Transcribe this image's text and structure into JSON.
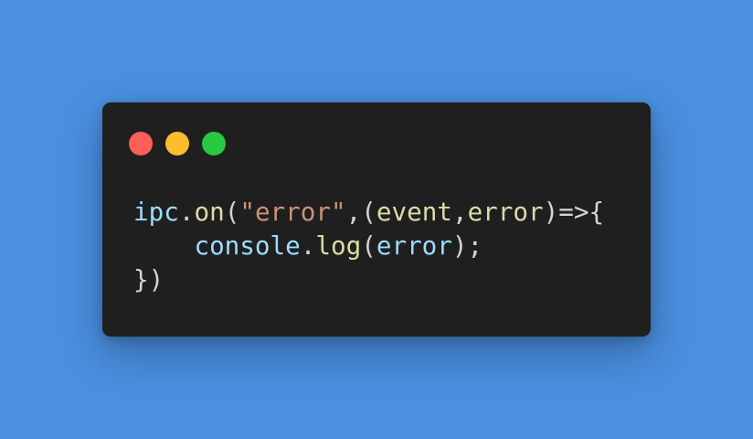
{
  "window": {
    "controls": [
      {
        "name": "close",
        "color": "#ff5f57"
      },
      {
        "name": "minimize",
        "color": "#febc2e"
      },
      {
        "name": "maximize",
        "color": "#28c840"
      }
    ]
  },
  "colors": {
    "background": "#4a8fe0",
    "window_bg": "#1f1f1f",
    "variable": "#9cdcfe",
    "function": "#dcdcaa",
    "string": "#ce9178",
    "punctuation": "#d4d4d4"
  },
  "code": {
    "line1": [
      {
        "text": "ipc",
        "kind": "variable"
      },
      {
        "text": ".",
        "kind": "punctuation"
      },
      {
        "text": "on",
        "kind": "function"
      },
      {
        "text": "(",
        "kind": "punctuation"
      },
      {
        "text": "\"error\"",
        "kind": "string"
      },
      {
        "text": ",(",
        "kind": "punctuation"
      },
      {
        "text": "event",
        "kind": "function"
      },
      {
        "text": ",",
        "kind": "punctuation"
      },
      {
        "text": "error",
        "kind": "function"
      },
      {
        "text": ")=>{",
        "kind": "punctuation"
      }
    ],
    "line2": [
      {
        "text": "    ",
        "kind": "punctuation"
      },
      {
        "text": "console",
        "kind": "variable"
      },
      {
        "text": ".",
        "kind": "punctuation"
      },
      {
        "text": "log",
        "kind": "function"
      },
      {
        "text": "(",
        "kind": "punctuation"
      },
      {
        "text": "error",
        "kind": "variable"
      },
      {
        "text": ");",
        "kind": "punctuation"
      }
    ],
    "line3": [
      {
        "text": "})",
        "kind": "punctuation"
      }
    ]
  }
}
